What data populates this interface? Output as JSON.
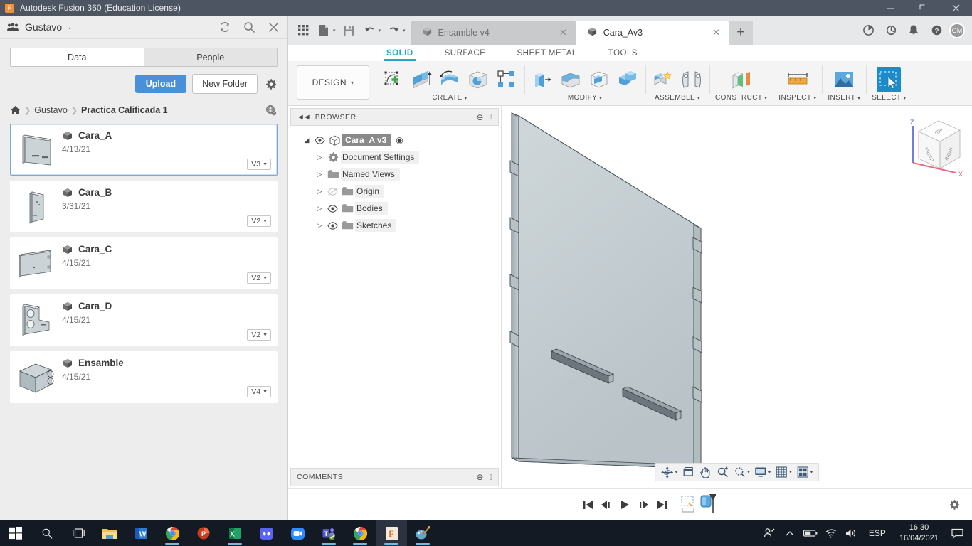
{
  "titlebar": {
    "app_title": "Autodesk Fusion 360 (Education License)",
    "logo_letter": "F",
    "minimize": "–",
    "maximize": "❐",
    "close": "✕"
  },
  "data_panel": {
    "user_name": "Gustavo",
    "user_caret": "⌄",
    "refresh_icon": "refresh-icon",
    "search_icon": "search-icon",
    "close_icon": "close-icon",
    "tabs": [
      {
        "label": "Data",
        "active": true
      },
      {
        "label": "People",
        "active": false
      }
    ],
    "upload_label": "Upload",
    "new_folder_label": "New Folder",
    "settings_icon": "gear-icon",
    "breadcrumb": {
      "home_icon": "home-icon",
      "separator": "❯",
      "items": [
        "Gustavo",
        "Practica Calificada 1"
      ],
      "globe_icon": "globe-icon"
    },
    "items": [
      {
        "name": "Cara_A",
        "date": "4/13/21",
        "version": "V3",
        "selected": true
      },
      {
        "name": "Cara_B",
        "date": "3/31/21",
        "version": "V2",
        "selected": false
      },
      {
        "name": "Cara_C",
        "date": "4/15/21",
        "version": "V2",
        "selected": false
      },
      {
        "name": "Cara_D",
        "date": "4/15/21",
        "version": "V2",
        "selected": false
      },
      {
        "name": "Ensamble",
        "date": "4/15/21",
        "version": "V4",
        "selected": false
      }
    ]
  },
  "quick_bar": {
    "grid_icon": "app-grid-icon",
    "new_doc_icon": "new-document-icon",
    "save_icon": "save-icon",
    "undo_icon": "undo-icon",
    "redo_icon": "redo-icon",
    "caret": "▾",
    "doc_tabs": [
      {
        "label": "Ensamble v4",
        "active": false,
        "close": "✕"
      },
      {
        "label": "Cara_Av3",
        "active": true,
        "close": "✕"
      }
    ],
    "add_tab": "+",
    "refresh_icon": "job-status-icon",
    "history_icon": "recent-icon",
    "bell_icon": "notifications-icon",
    "help_icon": "help-icon",
    "avatar_initials": "GM"
  },
  "ribbon": {
    "tabs": [
      {
        "label": "SOLID",
        "active": true
      },
      {
        "label": "SURFACE",
        "active": false
      },
      {
        "label": "SHEET METAL",
        "active": false
      },
      {
        "label": "TOOLS",
        "active": false
      }
    ],
    "design_label": "DESIGN",
    "design_caret": "▾",
    "groups": [
      {
        "label": "CREATE",
        "caret": "▾",
        "icons": [
          "create-sketch-icon",
          "extrude-icon",
          "revolve-icon",
          "hole-icon",
          "pattern-icon"
        ]
      },
      {
        "label": "MODIFY",
        "caret": "▾",
        "icons": [
          "press-pull-icon",
          "fillet-icon",
          "shell-icon",
          "combine-icon"
        ]
      },
      {
        "label": "ASSEMBLE",
        "caret": "▾",
        "icons": [
          "new-component-icon",
          "joint-icon"
        ]
      },
      {
        "label": "CONSTRUCT",
        "caret": "▾",
        "icons": [
          "offset-plane-icon"
        ]
      },
      {
        "label": "INSPECT",
        "caret": "▾",
        "icons": [
          "measure-icon"
        ]
      },
      {
        "label": "INSERT",
        "caret": "▾",
        "icons": [
          "insert-image-icon"
        ]
      },
      {
        "label": "SELECT",
        "caret": "▾",
        "icons": [
          "select-window-icon"
        ]
      }
    ]
  },
  "browser": {
    "header_label": "BROWSER",
    "collapse_icon": "collapse-left-icon",
    "minus_icon": "minus-circle-icon",
    "nodes": [
      {
        "label": "Cara_A v3",
        "arrow": "◢",
        "eye": "visible",
        "icon": "component-icon",
        "radio": "◉",
        "root": true,
        "indent": 0
      },
      {
        "label": "Document Settings",
        "arrow": "▷",
        "eye": "none",
        "icon": "gear-icon",
        "root": false,
        "indent": 1
      },
      {
        "label": "Named Views",
        "arrow": "▷",
        "eye": "none",
        "icon": "folder-icon",
        "root": false,
        "indent": 1
      },
      {
        "label": "Origin",
        "arrow": "▷",
        "eye": "hidden",
        "icon": "folder-icon",
        "root": false,
        "indent": 1
      },
      {
        "label": "Bodies",
        "arrow": "▷",
        "eye": "visible",
        "icon": "folder-icon",
        "root": false,
        "indent": 1
      },
      {
        "label": "Sketches",
        "arrow": "▷",
        "eye": "visible",
        "icon": "folder-icon",
        "root": false,
        "indent": 1
      }
    ],
    "footer_label": "COMMENTS",
    "footer_icon": "add-comment-icon"
  },
  "viewcube": {
    "top_face": "TOP",
    "front_face": "FRONT",
    "right_face": "RIGHT",
    "axis_z": "Z",
    "axis_x": "X"
  },
  "nav_bar": {
    "items": [
      {
        "icon": "orbit-icon",
        "caret": true
      },
      {
        "icon": "pan-cube-icon",
        "caret": false
      },
      {
        "icon": "pan-hand-icon",
        "caret": false
      },
      {
        "icon": "zoom-icon",
        "caret": false
      },
      {
        "icon": "zoom-window-icon",
        "caret": true
      },
      {
        "icon": "display-mode-icon",
        "caret": true
      },
      {
        "icon": "grid-snap-icon",
        "caret": true
      },
      {
        "icon": "viewports-icon",
        "caret": true
      }
    ]
  },
  "timeline": {
    "controls": [
      "go-to-start-icon",
      "step-back-icon",
      "play-icon",
      "step-forward-icon",
      "go-to-end-icon"
    ],
    "features": [
      "sketch-feature-icon",
      "extrude-feature-icon"
    ],
    "settings_icon": "gear-icon"
  },
  "taskbar": {
    "start_icon": "windows-start-icon",
    "search_icon": "search-icon",
    "taskview_icon": "task-view-icon",
    "apps": [
      {
        "name": "file-explorer-icon",
        "running": false,
        "active": false
      },
      {
        "name": "word-icon",
        "running": false,
        "active": false
      },
      {
        "name": "chrome-icon",
        "running": true,
        "active": false
      },
      {
        "name": "powerpoint-icon",
        "running": false,
        "active": false
      },
      {
        "name": "excel-icon",
        "running": true,
        "active": false
      },
      {
        "name": "discord-icon",
        "running": false,
        "active": false
      },
      {
        "name": "zoom-icon",
        "running": false,
        "active": false
      },
      {
        "name": "teams-icon",
        "running": true,
        "active": false
      },
      {
        "name": "chrome2-icon",
        "running": true,
        "active": false
      },
      {
        "name": "fusion360-icon",
        "running": true,
        "active": true
      },
      {
        "name": "paint3d-icon",
        "running": true,
        "active": false
      }
    ],
    "pen_icon": "pen-workspace-icon",
    "chevron_up": "^",
    "battery_icon": "battery-icon",
    "wifi_icon": "wifi-icon",
    "volume_icon": "volume-icon",
    "language": "ESP",
    "time": "16:30",
    "date": "16/04/2021",
    "notification_icon": "notifications-icon"
  },
  "colors": {
    "titlebar": "#4d5562",
    "accent_blue": "#2ba3c7",
    "upload_blue": "#4a90d9",
    "panel_bg": "#ededed",
    "select_blue": "#1a8ccb",
    "taskbar": "#131a24"
  }
}
